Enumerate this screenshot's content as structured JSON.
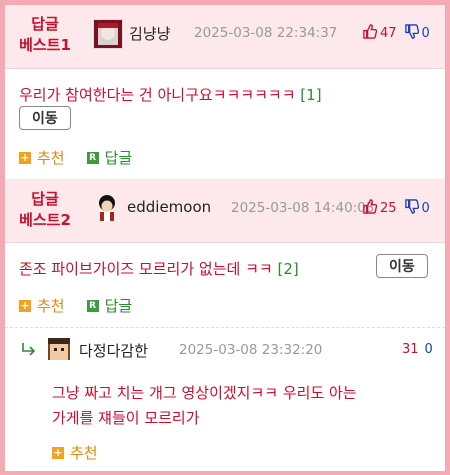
{
  "best1": {
    "label_line1": "답글",
    "label_line2": "베스트1",
    "nickname": "김냥냥",
    "date": "2025-03-08 22:34:37",
    "up_count": "47",
    "down_count": "0",
    "text": "우리가 참여한다는 건 아니구요ㅋㅋㅋㅋㅋㅋ",
    "reply_count": "[1]",
    "move_label": "이동",
    "recommend_label": "추천",
    "reply_label": "답글"
  },
  "best2": {
    "label_line1": "답글",
    "label_line2": "베스트2",
    "nickname": "eddiemoon",
    "date": "2025-03-08 14:40:03",
    "up_count": "25",
    "down_count": "0",
    "text": "존조 파이브가이즈 모르리가 없는데 ㅋㅋ",
    "reply_count": "[2]",
    "move_label": "이동",
    "recommend_label": "추천",
    "reply_label": "답글"
  },
  "reply": {
    "nickname": "다정다감한",
    "date": "2025-03-08 23:32:20",
    "up_count": "31",
    "down_count": "0",
    "text_line1": "그냥 짜고 치는 개그 영상이겠지ㅋㅋ 우리도 아는",
    "text_line2": "가게를 쟤들이 모르리가",
    "recommend_label": "추천"
  },
  "icons": {
    "thumb_up": "thumbs-up-icon",
    "thumb_down": "thumbs-down-icon",
    "recommend": "plus-square-icon",
    "reply": "r-square-icon",
    "reply_arrow": "reply-arrow-icon"
  },
  "colors": {
    "accent_red": "#c8102e",
    "down_blue": "#1a3fb5",
    "reply_green": "#2e8b2e",
    "recommend_orange": "#f2a31b",
    "best_bg": "#fde9eb",
    "frame_border": "#f5a9b2"
  }
}
